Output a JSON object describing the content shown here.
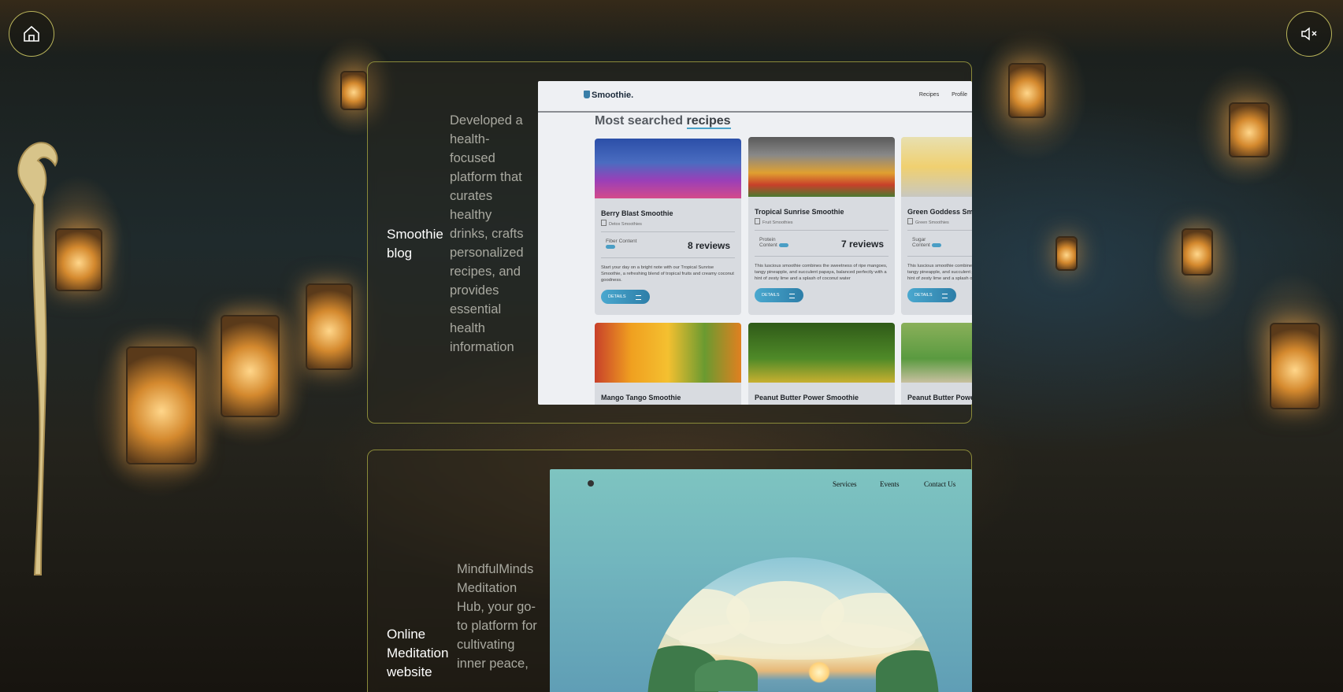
{
  "header": {
    "home_icon": "home-icon",
    "mute_icon": "speaker-muted-icon",
    "accent_color": "#b9b45a"
  },
  "projects": [
    {
      "title": "Smoothie blog",
      "description": "Developed a health-focused platform that curates healthy drinks, crafts personalized recipes, and provides essential health information",
      "preview": {
        "brand": "Smoothie.",
        "nav": [
          "Recipes",
          "Profile"
        ],
        "heading_plain": "Most searched",
        "heading_underlined": "recipes",
        "cards": [
          {
            "name": "Berry Blast Smoothie",
            "category": "Detox Smoothies",
            "attribute": "Fiber Content",
            "reviews": "8 reviews",
            "text": "Start your day on a bright note with our Tropical Sunrise Smoothie, a refreshing blend of tropical fruits and creamy coconut goodness.",
            "button": "DETAILS",
            "image_colors": [
              "#2b4fa8",
              "#9a3fb8",
              "#d44a8a"
            ]
          },
          {
            "name": "Tropical Sunrise Smoothie",
            "category": "Fruit Smoothies",
            "attribute": "Protein Content",
            "reviews": "7 reviews",
            "text": "This luscious smoothie combines the sweetness of ripe mangoes, tangy pineapple, and succulent papaya, balanced perfectly with a hint of zesty lime and a splash of coconut water",
            "button": "DETAILS",
            "image_colors": [
              "#5a5a5a",
              "#e0a030",
              "#c8402a"
            ]
          },
          {
            "name": "Green Goddess Smoothie",
            "category": "Green Smoothies",
            "attribute": "Sugar Content",
            "reviews": "",
            "text": "This luscious smoothie combines the sweetness of ripe mangoes, tangy pineapple, and succulent papaya, balanced perfectly with a hint of zesty lime and a splash of coconut water",
            "button": "DETAILS",
            "image_colors": [
              "#e8e0b0",
              "#f0d070",
              "#c8c8c0"
            ]
          },
          {
            "name": "Mango Tango Smoothie",
            "category": "",
            "image_colors": [
              "#c8402a",
              "#f0a020",
              "#6a9a30"
            ]
          },
          {
            "name": "Peanut Butter Power Smoothie",
            "category": "",
            "image_colors": [
              "#2f5a18",
              "#6a9a30",
              "#c8b030"
            ]
          },
          {
            "name": "Peanut Butter Power Smoothie",
            "category": "",
            "image_colors": [
              "#8ab05a",
              "#5a9a40",
              "#c8c0a0"
            ]
          }
        ]
      }
    },
    {
      "title": "Online Meditation website",
      "description": "MindfulMinds Meditation Hub, your go-to platform for cultivating inner peace,",
      "preview": {
        "nav": [
          "Services",
          "Events",
          "Contact Us"
        ]
      }
    }
  ]
}
